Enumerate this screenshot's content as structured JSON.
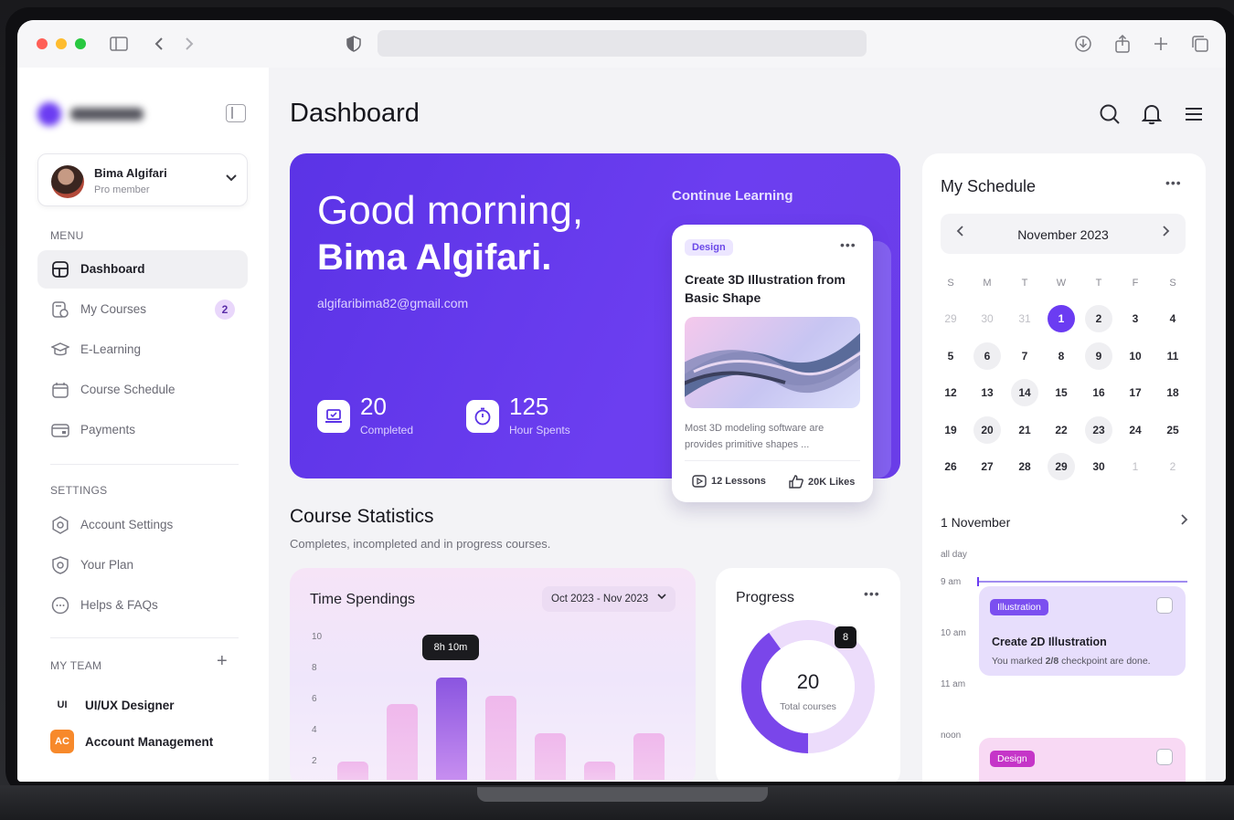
{
  "sidebar": {
    "user": {
      "name": "Bima Algifari",
      "role": "Pro member"
    },
    "menu_heading": "MENU",
    "menu": [
      {
        "label": "Dashboard"
      },
      {
        "label": "My Courses",
        "badge": "2"
      },
      {
        "label": "E-Learning"
      },
      {
        "label": "Course Schedule"
      },
      {
        "label": "Payments"
      }
    ],
    "settings_heading": "SETTINGS",
    "settings": [
      {
        "label": "Account Settings"
      },
      {
        "label": "Your Plan"
      },
      {
        "label": "Helps & FAQs"
      }
    ],
    "team_heading": "MY TEAM",
    "team": [
      {
        "abbr": "UI",
        "label": "UI/UX Designer",
        "color": "#ffffff"
      },
      {
        "abbr": "AC",
        "label": "Account Management",
        "color": "#f7892b"
      }
    ]
  },
  "header": {
    "title": "Dashboard"
  },
  "hero": {
    "greeting_line1": "Good morning,",
    "greeting_line2": "Bima Algifari.",
    "email": "algifaribima82@gmail.com",
    "stats": [
      {
        "value": "20",
        "label": "Completed"
      },
      {
        "value": "125",
        "label": "Hour Spents"
      }
    ],
    "continue_label": "Continue Learning",
    "course_card": {
      "tag": "Design",
      "title": "Create 3D Illustration from Basic Shape",
      "description": "Most 3D modeling software are provides primitive shapes ...",
      "lessons": "12 Lessons",
      "likes": "20K Likes"
    }
  },
  "course_stats": {
    "title": "Course Statistics",
    "subtitle": "Completes, incompleted and in progress courses."
  },
  "time_spendings": {
    "title": "Time Spendings",
    "range": "Oct 2023 - Nov 2023",
    "tooltip": "8h 10m",
    "y_ticks": [
      "10",
      "8",
      "6",
      "4",
      "2"
    ]
  },
  "chart_data": {
    "type": "bar",
    "title": "Time Spendings",
    "ylim": [
      0,
      10
    ],
    "values": [
      1.3,
      5.3,
      7.2,
      5.9,
      3.3,
      1.3,
      3.3
    ],
    "highlight_index": 2
  },
  "progress": {
    "title": "Progress",
    "total_value": "20",
    "total_label": "Total courses",
    "badge": "8",
    "completed_fraction": 0.4
  },
  "schedule": {
    "title": "My Schedule",
    "month": "November 2023",
    "weekdays": [
      "S",
      "M",
      "T",
      "W",
      "T",
      "F",
      "S"
    ],
    "weeks": [
      [
        "29",
        "30",
        "31",
        "1",
        "2",
        "3",
        "4"
      ],
      [
        "5",
        "6",
        "7",
        "8",
        "9",
        "10",
        "11"
      ],
      [
        "12",
        "13",
        "14",
        "15",
        "16",
        "17",
        "18"
      ],
      [
        "19",
        "20",
        "21",
        "22",
        "23",
        "24",
        "25"
      ],
      [
        "26",
        "27",
        "28",
        "29",
        "30",
        "1",
        "2"
      ]
    ],
    "selected_date": "1 November",
    "time_labels": [
      "all day",
      "9 am",
      "10 am",
      "11 am",
      "noon"
    ],
    "events": [
      {
        "tag": "Illustration",
        "title": "Create 2D Illustration",
        "desc_prefix": "You marked ",
        "desc_bold": "2/8",
        "desc_suffix": " checkpoint are done.",
        "tag_color": "#7b4ff0",
        "bg": "#e7defc"
      },
      {
        "tag": "Design",
        "tag_color": "#c535c8",
        "bg": "#f8d9f4"
      }
    ]
  }
}
